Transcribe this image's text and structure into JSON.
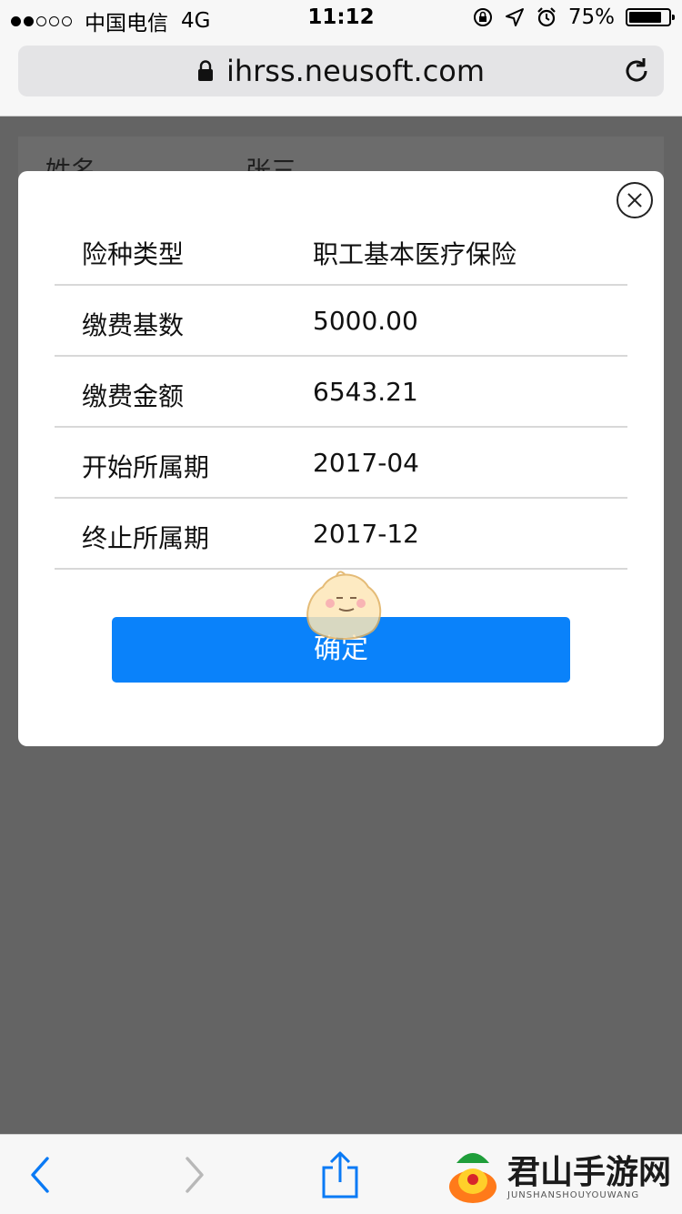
{
  "status_bar": {
    "carrier": "中国电信",
    "network": "4G",
    "time": "11:12",
    "battery_percent": "75%",
    "battery_level": 0.75
  },
  "browser": {
    "url": "ihrss.neusoft.com"
  },
  "background_page": {
    "first_row_label": "姓名",
    "first_row_value": "张三"
  },
  "modal": {
    "rows": [
      {
        "label": "险种类型",
        "value": "职工基本医疗保险"
      },
      {
        "label": "缴费基数",
        "value": "5000.00"
      },
      {
        "label": "缴费金额",
        "value": "6543.21"
      },
      {
        "label": "开始所属期",
        "value": "2017-04"
      },
      {
        "label": "终止所属期",
        "value": "2017-12"
      }
    ],
    "confirm_label": "确定"
  },
  "watermark": {
    "title": "君山手游网",
    "subtitle": "JUNSHANSHOUYOUWANG"
  },
  "colors": {
    "accent": "#0a82fa",
    "overlay": "#646464"
  }
}
